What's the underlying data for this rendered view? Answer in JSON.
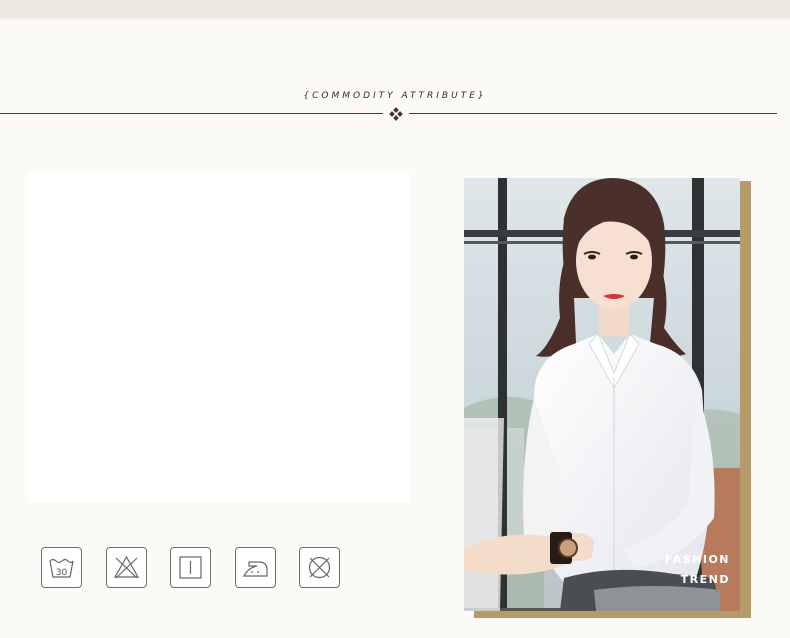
{
  "section": {
    "title": "{COMMODITY ATTRIBUTE}"
  },
  "care_icons": [
    {
      "name": "wash-30-icon",
      "label": "30"
    },
    {
      "name": "no-bleach-icon"
    },
    {
      "name": "tumble-dry-icon"
    },
    {
      "name": "iron-low-icon"
    },
    {
      "name": "no-dry-clean-icon"
    }
  ],
  "photo": {
    "caption_line1": "FASHION",
    "caption_line2": "TREND"
  },
  "colors": {
    "background": "#fcfaf6",
    "accent_frame": "#b59a6a",
    "title_text": "#3a2a2a"
  }
}
